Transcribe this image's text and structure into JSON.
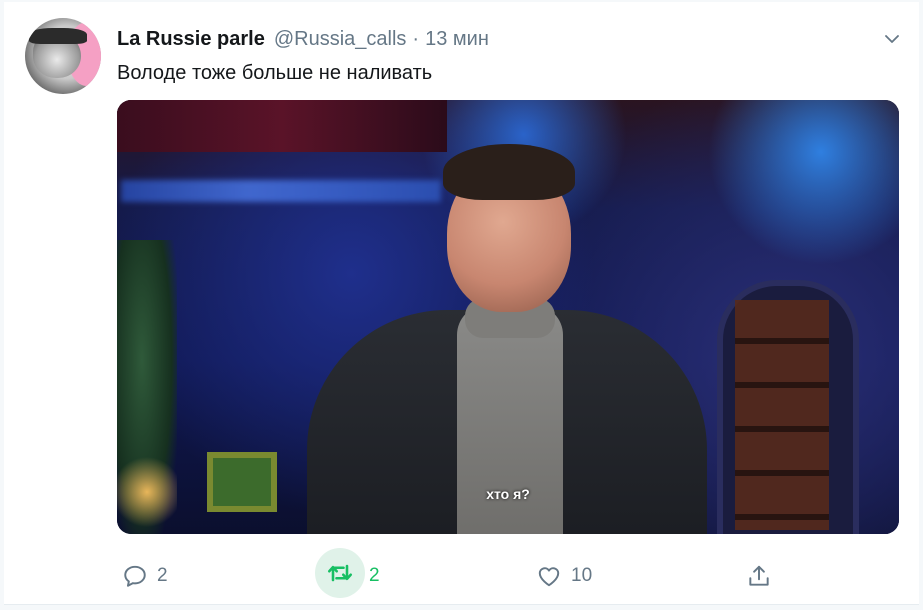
{
  "tweet": {
    "author_name": "La Russie parle",
    "author_handle": "@Russia_calls",
    "separator": "·",
    "time": "13 мин",
    "text": "Володе тоже больше не наливать",
    "media": {
      "caption": "хто я?"
    },
    "actions": {
      "reply_count": "2",
      "retweet_count": "2",
      "like_count": "10"
    }
  },
  "colors": {
    "text_primary": "#14171a",
    "text_secondary": "#657786",
    "retweet_active": "#17bf63",
    "retweet_bg": "#e0f2e9",
    "avatar_accent": "#f5a0c4"
  },
  "icons": {
    "more": "chevron-down-icon",
    "reply": "reply-icon",
    "retweet": "retweet-icon",
    "like": "heart-icon",
    "share": "share-icon"
  }
}
